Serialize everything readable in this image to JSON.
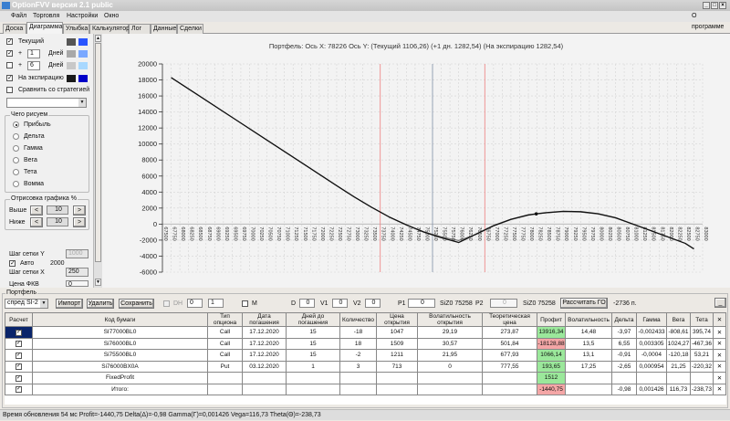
{
  "window": {
    "title": "OptionFVV версия 2.1 public",
    "menu": [
      "Файл",
      "Торговля",
      "Настройки",
      "Окно"
    ],
    "about": "О программе"
  },
  "tabs": [
    "Доска",
    "Диаграмма",
    "Улыбка",
    "Калькулятор",
    "Лог",
    "Данные",
    "Сделки"
  ],
  "active_tab": "Диаграмма",
  "left": {
    "rows": [
      {
        "checked": true,
        "label": "Текущий",
        "colors": [
          "#555555",
          "#2a55ff"
        ]
      },
      {
        "checked": true,
        "plus": "+",
        "days": "1",
        "days_label": "Дней",
        "colors": [
          "#a8a8a8",
          "#7aa8ff"
        ]
      },
      {
        "checked": false,
        "plus": "+",
        "days": "6",
        "days_label": "Дней",
        "colors": [
          "#c8c8c8",
          "#a8d8ff"
        ]
      },
      {
        "checked": true,
        "label": "На экспирацию",
        "colors": [
          "#1a1a1a",
          "#0000c8"
        ]
      }
    ],
    "compare": {
      "checked": false,
      "label": "Сравнить со стратегией"
    },
    "what_group": {
      "title": "Чего рисуем",
      "options": [
        "Прибыль",
        "Дельта",
        "Гамма",
        "Вега",
        "Тета",
        "Вомма"
      ],
      "selected": "Прибыль"
    },
    "draw_group": {
      "title": "Отрисовка графика %",
      "above_label": "Выше",
      "above": "10",
      "below_label": "Ниже",
      "below": "10",
      "dec": "<",
      "inc": ">"
    },
    "grid_y_label": "Шаг сетки Y",
    "grid_y": "1000",
    "auto_checked": true,
    "auto_label": "Авто",
    "auto_value": "2000",
    "grid_x_label": "Шаг сетки X",
    "grid_x": "250",
    "partial_label": "Цена ФКВ",
    "partial_value": "0"
  },
  "chart_data": {
    "type": "line",
    "title": "Портфель: Ось X: 78226 Ось Y:  (Текущий 1106,26)  (+1 дн. 1282,54)  (На экспирацию 1282,54)",
    "xlim": [
      67500,
      83000
    ],
    "xtick_step": 250,
    "ylim": [
      -6000,
      20000
    ],
    "ytick_step": 2000,
    "grid": true,
    "vlines": [
      {
        "x": 73750,
        "color": "#f08080"
      },
      {
        "x": 75250,
        "color": "#8090a8"
      },
      {
        "x": 76750,
        "color": "#f08080"
      }
    ],
    "marker": {
      "x": 78226,
      "y": 1282.54
    },
    "x": [
      67750,
      68500,
      69500,
      70500,
      71500,
      72500,
      73000,
      73500,
      74000,
      74500,
      75000,
      75500,
      76000,
      76500,
      77000,
      77500,
      78000,
      78226,
      78500,
      79000,
      79500,
      80000,
      80500,
      81000,
      81500,
      82000,
      82500,
      82750
    ],
    "series": [
      {
        "color": "#666666",
        "values": [
          18300,
          16170,
          13330,
          10490,
          7650,
          4800,
          3400,
          2100,
          900,
          -100,
          -950,
          -1600,
          -2050,
          -1300,
          -250,
          550,
          1100,
          1250,
          1400,
          1550,
          1500,
          1250,
          750,
          0,
          -800,
          -1600,
          -2400,
          -3100
        ]
      },
      {
        "color": "#111111",
        "values": [
          18300,
          16170,
          13330,
          10490,
          7650,
          4800,
          3400,
          2100,
          900,
          -100,
          -1000,
          -1700,
          -2300,
          -1250,
          -200,
          600,
          1150,
          1282,
          1420,
          1600,
          1550,
          1300,
          800,
          0,
          -800,
          -1600,
          -2400,
          -3100
        ]
      }
    ]
  },
  "portfolio": {
    "title": "Портфель",
    "strategy": "спред SI-2",
    "import": "Импорт",
    "delete": "Удалить",
    "save": "Сохранить",
    "dh_label": "DH",
    "dh1": "0",
    "dh2": "1",
    "m_label": "M",
    "d_label": "D",
    "d": "0",
    "v1_label": "V1",
    "v1": "0",
    "v2_label": "V2",
    "v2": "0",
    "p1_label": "P1",
    "p1": "0",
    "p1_sec": "SiZ0 75258",
    "p2_label": "P2",
    "p2": "0",
    "p2_sec": "SiZ0 75258",
    "calc_go": "Рассчитать ГО",
    "go_value": "-2736 п.",
    "min_btn": "_"
  },
  "table": {
    "headers": [
      "Расчет",
      "Код бумаги",
      "Тип опциона",
      "Дата погашения",
      "Дней до погашения",
      "Количество",
      "Цена открытия",
      "Волатильность открытия",
      "Теоретическая цена",
      "Профит",
      "Волатильность",
      "Дельта",
      "Гамма",
      "Вега",
      "Тета",
      "✕"
    ],
    "rows": [
      [
        "SI77000BL0",
        "Call",
        "17.12.2020",
        "15",
        "-18",
        "1047",
        "29,19",
        "273,87",
        "13916,34",
        "14,48",
        "-3,97",
        "-0,002433",
        "-808,61",
        "395,74"
      ],
      [
        "Si76000BL0",
        "Call",
        "17.12.2020",
        "15",
        "18",
        "1509",
        "30,57",
        "501,84",
        "-18128,88",
        "13,5",
        "6,55",
        "0,003305",
        "1024,27",
        "-467,36"
      ],
      [
        "Si75500BL0",
        "Call",
        "17.12.2020",
        "15",
        "-2",
        "1211",
        "21,95",
        "677,93",
        "1066,14",
        "13,1",
        "-0,91",
        "-0,0004",
        "-120,18",
        "53,21"
      ],
      [
        "Si76000BX0A",
        "Put",
        "03.12.2020",
        "1",
        "3",
        "713",
        "0",
        "777,55",
        "193,65",
        "17,25",
        "-2,65",
        "0,000954",
        "21,25",
        "-220,32"
      ],
      [
        "FixedProfit",
        "",
        "",
        "",
        "",
        "",
        "",
        "",
        "1512",
        "",
        "",
        "",
        "",
        ""
      ],
      [
        "Итого:",
        "",
        "",
        "",
        "",
        "",
        "",
        "",
        "-1440,75",
        "",
        "-0,98",
        "0,001426",
        "116,73",
        "-238,73"
      ]
    ],
    "profit_colors": [
      "g",
      "r",
      "g",
      "g",
      "g",
      "r"
    ]
  },
  "status": "Время обновления 54 мс  Profit=-1440,75 Delta(Δ)=-0,98 Gamma(Γ)=0,001426 Vega=116,73 Theta(Θ)=-238,73"
}
